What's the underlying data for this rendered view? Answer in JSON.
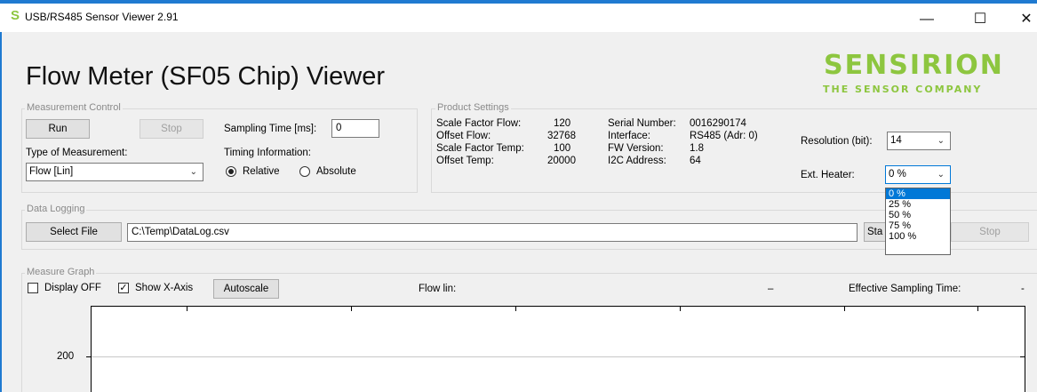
{
  "window": {
    "title": "USB/RS485 Sensor Viewer 2.91",
    "icon": "sensirion-s-icon",
    "minimize": "—",
    "maximize": "☐",
    "close": "✕"
  },
  "header": {
    "title": "Flow Meter (SF05 Chip) Viewer",
    "logo_main": "SENSIRION",
    "logo_sub": "THE SENSOR COMPANY",
    "brand_color": "#8dc63f"
  },
  "measurement_control": {
    "label": "Measurement Control",
    "run_label": "Run",
    "stop_label": "Stop",
    "sampling_label": "Sampling Time [ms]:",
    "sampling_value": "0",
    "type_label": "Type of Measurement:",
    "type_value": "Flow [Lin]",
    "timing_label": "Timing Information:",
    "relative_label": "Relative",
    "absolute_label": "Absolute",
    "timing_selected": "Relative"
  },
  "product_settings": {
    "label": "Product Settings",
    "rows": [
      {
        "label": "Scale Factor Flow:",
        "value": "120"
      },
      {
        "label": "Offset Flow:",
        "value": "32768"
      },
      {
        "label": "Scale Factor Temp:",
        "value": "100"
      },
      {
        "label": "Offset Temp:",
        "value": "20000"
      }
    ],
    "info": [
      {
        "label": "Serial Number:",
        "value": "0016290174"
      },
      {
        "label": "Interface:",
        "value": "RS485 (Adr: 0)"
      },
      {
        "label": "FW Version:",
        "value": "1.8"
      },
      {
        "label": "I2C Address:",
        "value": "64"
      }
    ],
    "resolution_label": "Resolution (bit):",
    "resolution_value": "14",
    "heater_label": "Ext. Heater:",
    "heater_value": "0 %",
    "heater_options": [
      "0 %",
      "25 %",
      "50 %",
      "75 %",
      "100 %"
    ]
  },
  "data_logging": {
    "label": "Data Logging",
    "select_file_label": "Select File",
    "path": "C:\\Temp\\DataLog.csv",
    "start_label": "Sta",
    "stop_label": "Stop"
  },
  "measure_graph": {
    "label": "Measure Graph",
    "display_off_label": "Display OFF",
    "display_off_checked": false,
    "show_x_axis_label": "Show X-Axis",
    "show_x_axis_checked": true,
    "autoscale_label": "Autoscale",
    "flow_label": "Flow lin:",
    "flow_value": "–",
    "sampling_label": "Effective Sampling Time:",
    "sampling_value": "-",
    "y_tick": "200"
  }
}
